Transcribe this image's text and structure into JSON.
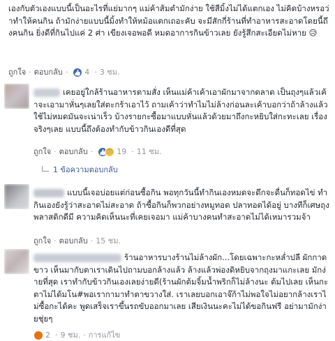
{
  "comments": [
    {
      "text": "เองกับตัวเองแบบนี้เป็นอะไรที่แย่มากๆ แม่ค้าส้มตำมักง่าย ใช้สีมิ้งไม่ได้แตกเอง ไม่คิดบ้างหรอว่าทำให้คนกิน ถ้ามักง่ายแบบนี้มิ้งทำให้หม้อแตกเถอะคับ จะมีสักกี่ร้านที่ทำอาหารสะอาดโดยนี้ถึงคนกิน ยิ่งดีที่กินไปแค่ 2 ศ่า เขียงเจอพอดี หมดอาการกินข้าวเลย ยังรู้สึกสะเอียดไม่หาย 😥",
      "like_label": "ถูกใจ",
      "reply_label": "ตอบกลับ",
      "reaction_count": "4",
      "time": "3 ชม."
    },
    {
      "text": "เคยอยู่ใกล้ร้านอาหารตามสั่ง เห็นแม่ค้าเค้าเอาผักมาจากตลาด เป็นถุงๆแล้วเค้าจะเอามาหั่นๆเลยใส่ตะกร้าเอาไว้ ถามเค้าว่าทำไมไม่ล้างก่อนละเค้าบอกว่าถ้าล้างแล้วใช้ไม่หมดมันจะเน่าเร็ว บ้างรายกะซื้อมาแบบหั่นแล้วด้วยมาถึงกะหยิบใส่กะทะเลย เรื่องจริงๆเลย แบบนี้ถึงต้องทำกับข้าวกินเองดีที่สุด",
      "like_label": "ถูกใจ",
      "reply_label": "ตอบกลับ",
      "reaction_count": "19",
      "time": "11 ชม.",
      "replies_label": "1 ข้อความตอบกลับ"
    },
    {
      "text": "แบบนี้เจอบ่อยแต่ก่อนซื้อกิน พอทุกวันนี้ทำกินเองหมดจะดึกจะดื่นก็ทอดไข่ ทำกินเองยังรู้ว่าสะอาดไม่สะอาด ถ้าซื้อกินก็พวกอย่างหมูทอด ปลาทอดได้อยู่ บางทีก็เศษถุงพลาสติกดีมี ความคิดเห็นนะที่เคยเจอมา แม่ค้าบางคนทำสะอาดไม่ได้เหมารวมจ้า",
      "like_label": "ถูกใจ",
      "reply_label": "ตอบกลับ",
      "time": "15 ชม."
    },
    {
      "text": "ร้านอาหารบางร้านไม่ล้างผัก...โดยเฉพาะกะหล่ำปลี ผักกาดขาว เห็นมากับตาเราเดินไปถามบอกล้างแล้ว ล้างแล้วพ่องดิหยิบจากถุงมาแกะเลย มักง่ายที่สุด เราทำกับข้าวกินเองเลยง่ายดี(ร้านผักต้มจิ้มน้ำพริกก็ไม่ล้างนะ ต้มไปเลย เห็นกะตาไม่ได้มโน#พอเรากามาทำตาขวางใส่. เราเลยบอกเอาจ๊ก้าไม่พอใจไม่อยากล้างเราไม่ซื้อกะได้คะ พูดเสร็จเราขึ้นรถขับออกมาเลย เสียเงินนะคะไม่ได้ขอกินฟรี อย่ามามักง่ายชุ่ยๆ",
      "like_label": "ถูกใจ",
      "reply_label": "ตอบกลับ",
      "reaction_count": "2",
      "time": "9 ชม.",
      "edited_label": "การแก้ไข"
    }
  ],
  "colors": {
    "link": "#365899",
    "meta": "#90949c",
    "text": "#1d2129",
    "like_blue": "#4267b2"
  }
}
